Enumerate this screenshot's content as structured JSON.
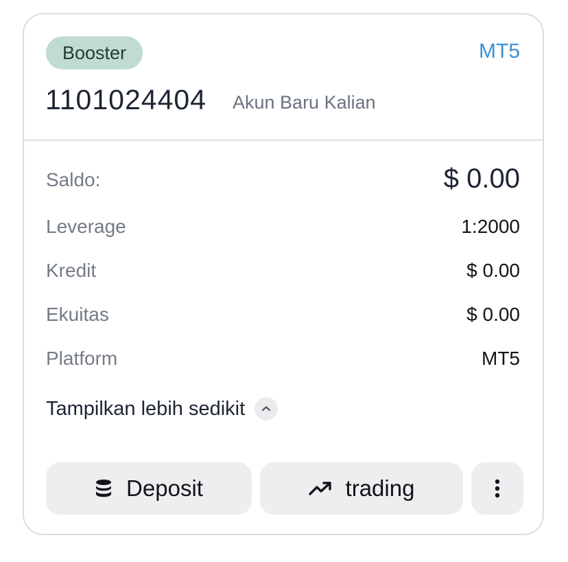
{
  "card": {
    "badge": "Booster",
    "platform_tag": "MT5",
    "account_number": "1101024404",
    "account_name": "Akun Baru Kalian",
    "badge_color": "#bfdbd3",
    "accent_color": "#3a8fd9"
  },
  "details": {
    "saldo_label": "Saldo:",
    "saldo_value": "$ 0.00",
    "leverage_label": "Leverage",
    "leverage_value": "1:2000",
    "kredit_label": "Kredit",
    "kredit_value": "$ 0.00",
    "ekuitas_label": "Ekuitas",
    "ekuitas_value": "$ 0.00",
    "platform_label": "Platform",
    "platform_value": "MT5"
  },
  "toggle": {
    "label": "Tampilkan lebih sedikit",
    "icon": "chevron-up-icon"
  },
  "actions": {
    "deposit_label": "Deposit",
    "deposit_icon": "database-icon",
    "trading_label": "trading",
    "trading_icon": "trending-up-icon",
    "more_icon": "more-vertical-icon"
  }
}
